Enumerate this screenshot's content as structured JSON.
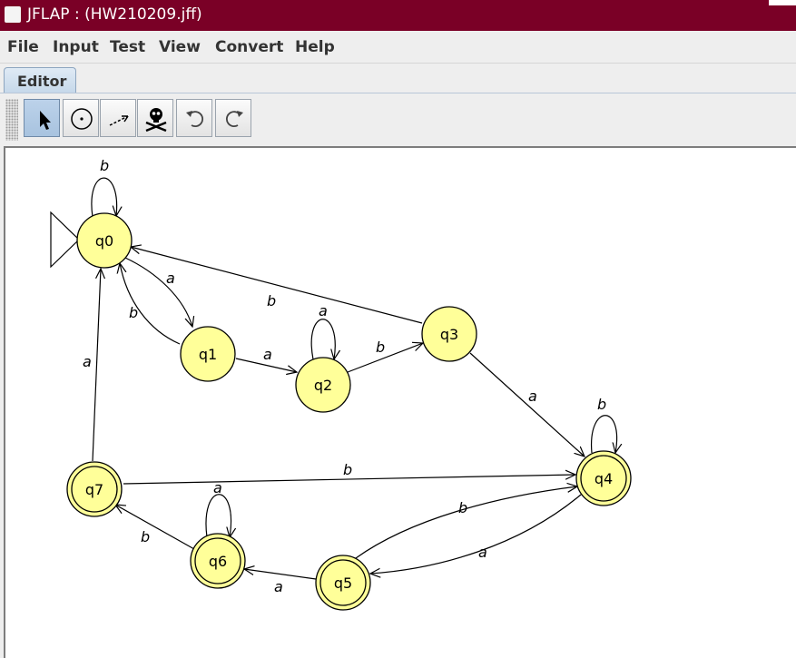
{
  "window": {
    "title": "JFLAP : (HW210209.jff)"
  },
  "menu": [
    "File",
    "Input",
    "Test",
    "View",
    "Convert",
    "Help"
  ],
  "tabs": [
    "Editor"
  ],
  "toolbar": {
    "tools": [
      "attribute-editor",
      "state-creator",
      "transition-creator",
      "deleter",
      "undo",
      "redo"
    ],
    "active": "attribute-editor"
  },
  "colors": {
    "titlebar": "#7a0026",
    "state_fill": "#ffff99",
    "state_stroke": "#000000",
    "edge": "#000000"
  },
  "states": {
    "q0": {
      "label": "q0",
      "initial": true,
      "final": false
    },
    "q1": {
      "label": "q1",
      "initial": false,
      "final": false
    },
    "q2": {
      "label": "q2",
      "initial": false,
      "final": false
    },
    "q3": {
      "label": "q3",
      "initial": false,
      "final": false
    },
    "q4": {
      "label": "q4",
      "initial": false,
      "final": true
    },
    "q5": {
      "label": "q5",
      "initial": false,
      "final": true
    },
    "q6": {
      "label": "q6",
      "initial": false,
      "final": true
    },
    "q7": {
      "label": "q7",
      "initial": false,
      "final": true
    }
  },
  "transitions": [
    {
      "from": "q0",
      "to": "q0",
      "symbol": "b"
    },
    {
      "from": "q0",
      "to": "q1",
      "symbol": "a"
    },
    {
      "from": "q1",
      "to": "q0",
      "symbol": "b"
    },
    {
      "from": "q1",
      "to": "q2",
      "symbol": "a"
    },
    {
      "from": "q2",
      "to": "q2",
      "symbol": "a"
    },
    {
      "from": "q2",
      "to": "q3",
      "symbol": "b"
    },
    {
      "from": "q3",
      "to": "q0",
      "symbol": "b"
    },
    {
      "from": "q3",
      "to": "q4",
      "symbol": "a"
    },
    {
      "from": "q4",
      "to": "q4",
      "symbol": "b"
    },
    {
      "from": "q4",
      "to": "q5",
      "symbol": "a"
    },
    {
      "from": "q5",
      "to": "q4",
      "symbol": "b"
    },
    {
      "from": "q5",
      "to": "q6",
      "symbol": "a"
    },
    {
      "from": "q6",
      "to": "q6",
      "symbol": "a"
    },
    {
      "from": "q6",
      "to": "q7",
      "symbol": "b"
    },
    {
      "from": "q7",
      "to": "q0",
      "symbol": "a"
    },
    {
      "from": "q7",
      "to": "q4",
      "symbol": "b"
    }
  ]
}
